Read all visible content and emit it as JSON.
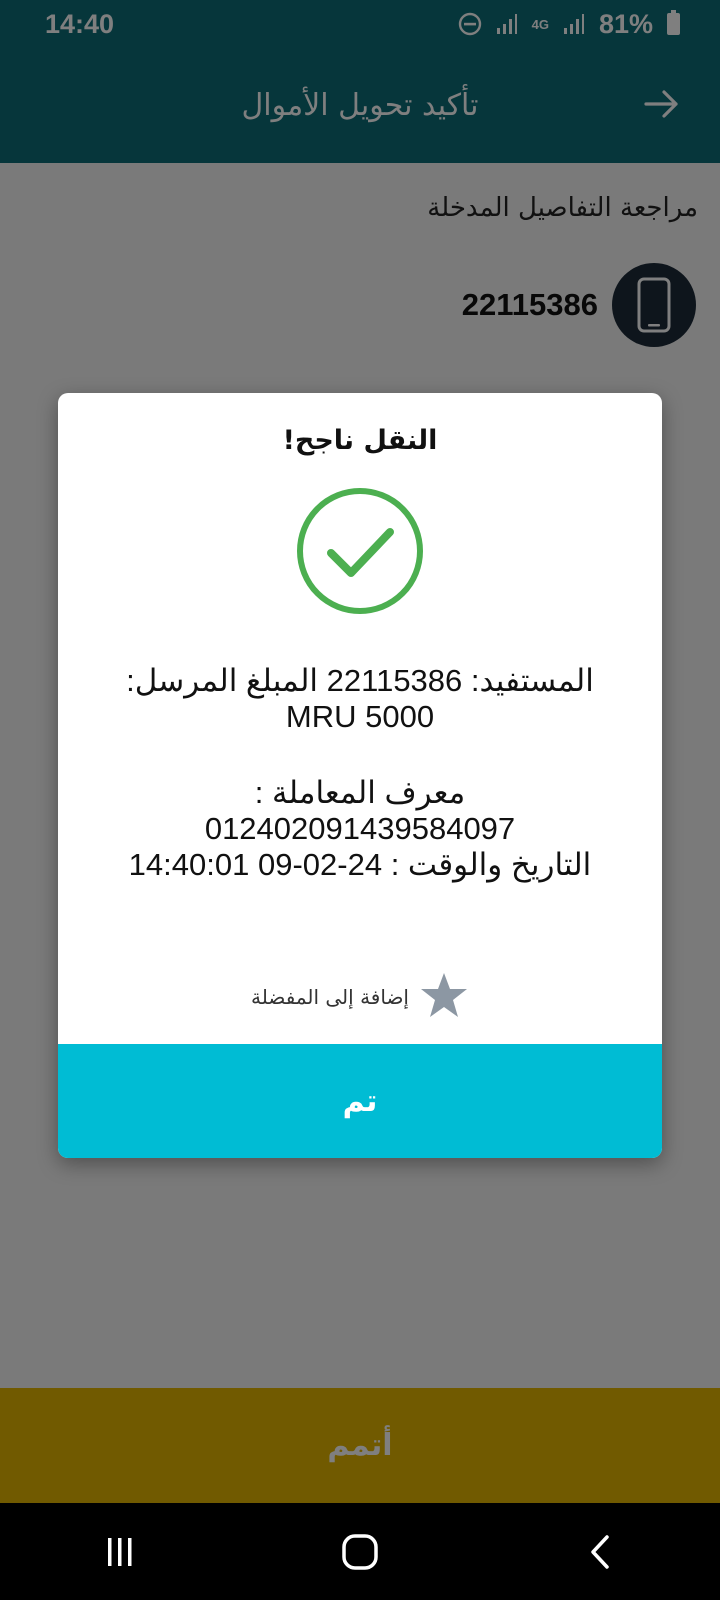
{
  "status_bar": {
    "time": "14:40",
    "network": "4G",
    "battery": "81%",
    "icons": [
      "dnd-icon",
      "signal-icon",
      "4g-icon",
      "signal-icon",
      "battery-icon"
    ]
  },
  "header": {
    "title": "تأكيد تحويل الأموال",
    "back_icon": "arrow-right-icon"
  },
  "review": {
    "label": "مراجعة التفاصيل المدخلة",
    "recipient_number": "22115386",
    "avatar_icon": "phone-icon"
  },
  "dialog": {
    "title": "النقل ناجح!",
    "success_icon": "check-circle-icon",
    "beneficiary_line": "المستفيد: 22115386 المبلغ المرسل: 5000 MRU",
    "transaction_label": "معرف المعاملة :",
    "transaction_id": "012402091439584097",
    "datetime_line": "التاريخ والوقت : 24-02-09 14:40:01",
    "favorite_label": "إضافة إلى المفضلة",
    "favorite_icon": "star-icon",
    "done_label": "تم"
  },
  "footer": {
    "confirm_label": "أتمم"
  },
  "colors": {
    "header": "#0d6d77",
    "done_button": "#00bcd4",
    "confirm_bar": "#e2b400",
    "success_green": "#4caf50"
  }
}
